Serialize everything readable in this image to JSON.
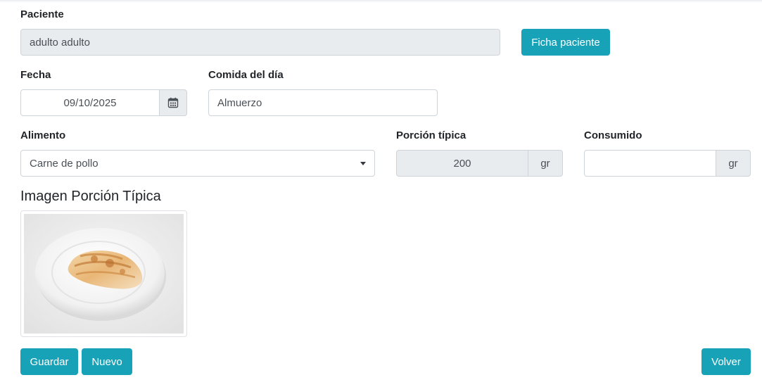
{
  "patient": {
    "label": "Paciente",
    "value": "adulto adulto",
    "sheet_button": "Ficha paciente"
  },
  "date": {
    "label": "Fecha",
    "value": "09/10/2025"
  },
  "meal": {
    "label": "Comida del día",
    "value": "Almuerzo"
  },
  "food": {
    "label": "Alimento",
    "selected": "Carne de pollo"
  },
  "typical_portion": {
    "label": "Porción típica",
    "value": "200",
    "unit": "gr"
  },
  "consumed": {
    "label": "Consumido",
    "value": "",
    "unit": "gr"
  },
  "image_section": {
    "title": "Imagen Porción Típica"
  },
  "actions": {
    "save": "Guardar",
    "new": "Nuevo",
    "back": "Volver"
  },
  "colors": {
    "primary": "#17a2b8",
    "readonly_bg": "#e9ecef",
    "border": "#ced4da"
  }
}
